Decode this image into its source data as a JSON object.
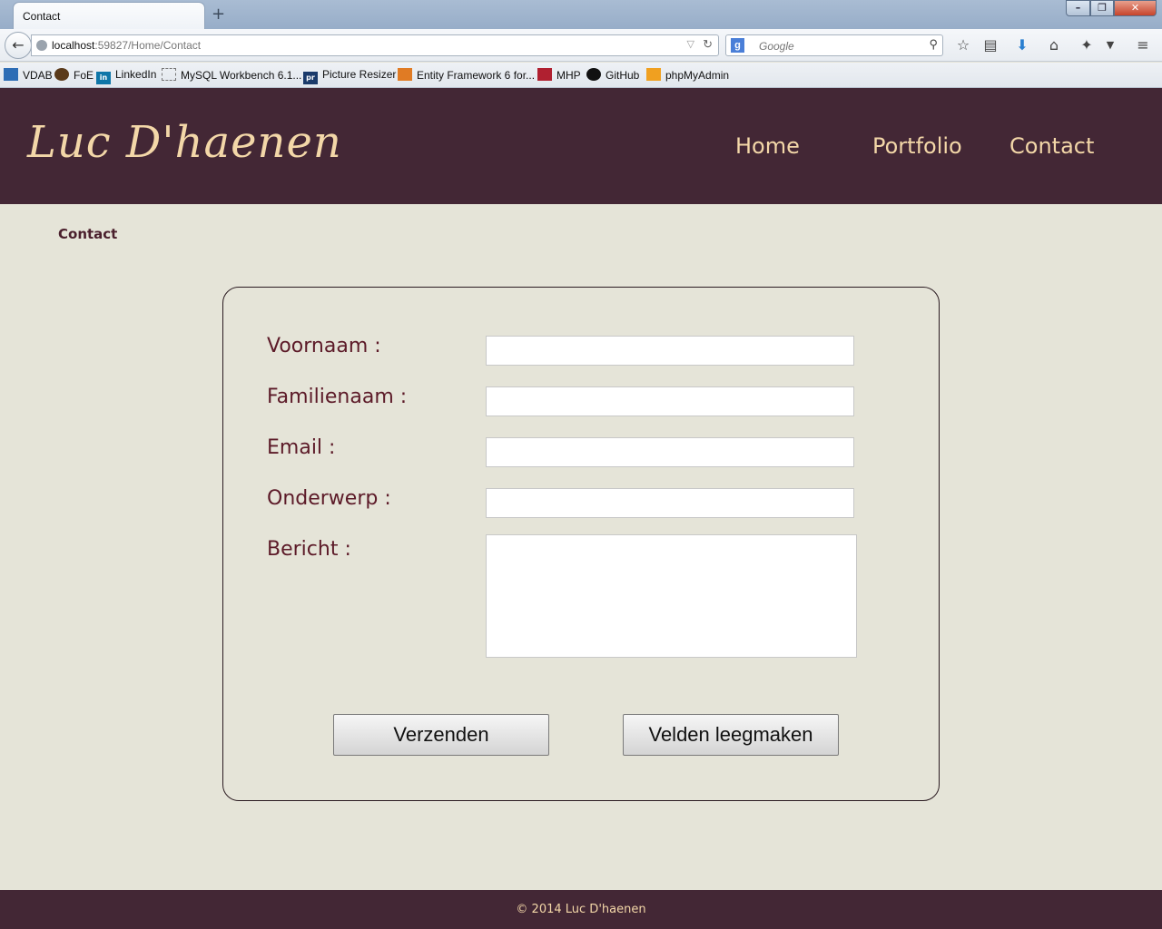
{
  "browser": {
    "tab_title": "Contact",
    "new_tab_symbol": "+",
    "url_host": "localhost",
    "url_rest": ":59827/Home/Contact",
    "search_placeholder": "Google",
    "bookmarks": [
      "VDAB",
      "FoE",
      "LinkedIn",
      "MySQL Workbench 6.1...",
      "Picture Resizer",
      "Entity Framework 6 for...",
      "MHP",
      "GitHub",
      "phpMyAdmin"
    ]
  },
  "site": {
    "logo": "Luc D'haenen",
    "nav": [
      "Home",
      "Portfolio",
      "Contact"
    ],
    "breadcrumb": "Contact",
    "colors": {
      "header_bg": "#432735",
      "accent_text": "#f3d7a8",
      "label_text": "#5c1a28",
      "page_bg": "#e5e4d8"
    }
  },
  "form": {
    "fields": [
      {
        "label": "Voornaam :",
        "value": ""
      },
      {
        "label": "Familienaam :",
        "value": ""
      },
      {
        "label": "Email :",
        "value": ""
      },
      {
        "label": "Onderwerp :",
        "value": ""
      },
      {
        "label": "Bericht :",
        "value": ""
      }
    ],
    "submit_label": "Verzenden",
    "reset_label": "Velden leegmaken"
  },
  "footer": {
    "text": "© 2014 Luc D'haenen"
  }
}
